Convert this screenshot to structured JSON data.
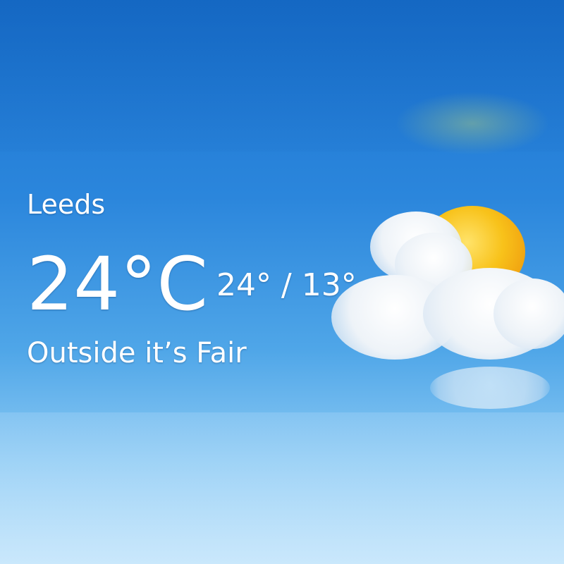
{
  "weather": {
    "city": "Leeds",
    "temperature": "24°C",
    "hi_lo": "24° / 13°",
    "condition_text": "Outside it’s Fair"
  },
  "illustration": {
    "icon": "partly-sunny-icon"
  },
  "colors": {
    "sky_top": "#1a74d0",
    "sky_bottom": "#c3e5fb",
    "text": "#ffffff",
    "sun": "#f8c21a"
  }
}
